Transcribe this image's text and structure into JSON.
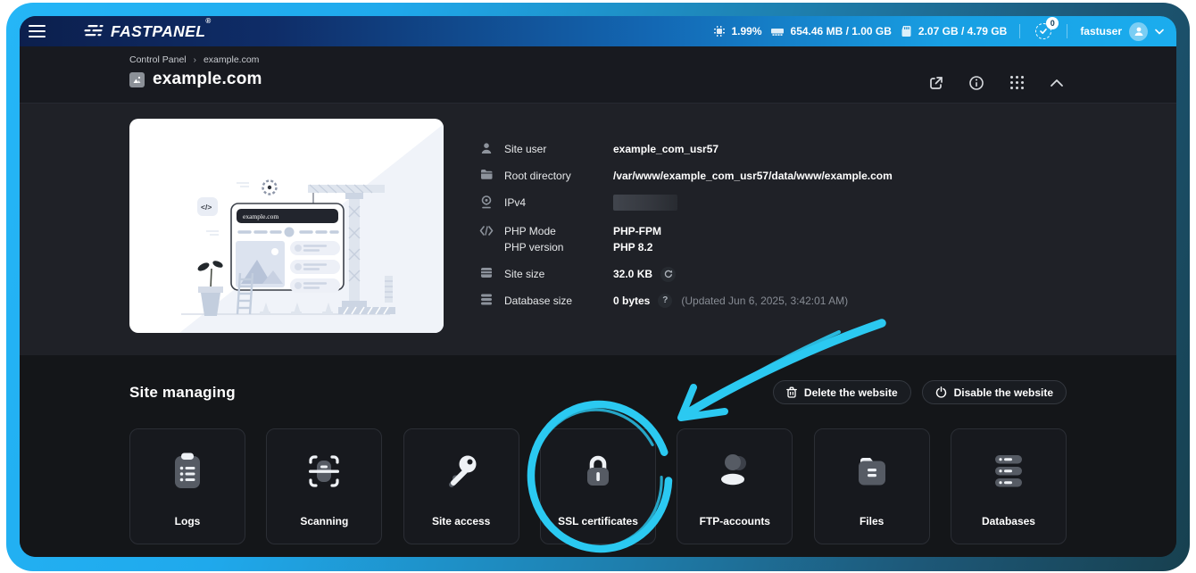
{
  "topbar": {
    "logo_text": "FASTPANEL",
    "logo_reg": "®",
    "cpu_usage": "1.99%",
    "ram_usage": "654.46 MB / 1.00 GB",
    "disk_usage": "2.07 GB / 4.79 GB",
    "notifications_count": "0",
    "username": "fastuser"
  },
  "breadcrumb": {
    "parent": "Control Panel",
    "separator": "›",
    "current": "example.com"
  },
  "page": {
    "title": "example.com"
  },
  "illustration": {
    "site_label": "example.com"
  },
  "site_info": {
    "user_label": "Site user",
    "user_value": "example_com_usr57",
    "root_label": "Root directory",
    "root_value": "/var/www/example_com_usr57/data/www/example.com",
    "ipv4_label": "IPv4",
    "php_mode_label": "PHP Mode",
    "php_mode_value": "PHP-FPM",
    "php_version_label": "PHP version",
    "php_version_value": "PHP 8.2",
    "site_size_label": "Site size",
    "site_size_value": "32.0 KB",
    "db_size_label": "Database size",
    "db_size_value": "0 bytes",
    "db_size_updated": "(Updated Jun 6, 2025, 3:42:01 AM)",
    "help_glyph": "?"
  },
  "managing": {
    "title": "Site managing",
    "delete_button": "Delete the website",
    "disable_button": "Disable the website",
    "cards": [
      {
        "label": "Logs",
        "icon": "logs-icon"
      },
      {
        "label": "Scanning",
        "icon": "scan-icon"
      },
      {
        "label": "Site access",
        "icon": "key-icon"
      },
      {
        "label": "SSL certificates",
        "icon": "lock-icon"
      },
      {
        "label": "FTP-accounts",
        "icon": "users-icon"
      },
      {
        "label": "Files",
        "icon": "folder-icon"
      },
      {
        "label": "Databases",
        "icon": "database-icon"
      }
    ]
  },
  "colors": {
    "annotation_cyan": "#2bc9f1",
    "topbar_navy": "#0c1f4d",
    "topbar_cyan": "#1badee",
    "section_light": "#1f2127",
    "section_dark": "#141619"
  }
}
